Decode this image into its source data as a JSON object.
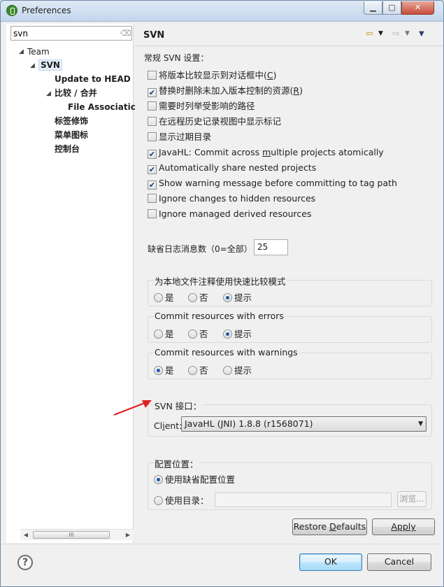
{
  "window": {
    "title": "Preferences",
    "min_label": "▁",
    "max_label": "▢",
    "close_label": "✕"
  },
  "left": {
    "search_value": "svn",
    "tree": [
      {
        "label": "Team",
        "arrow": "◢",
        "bold": false
      },
      {
        "label": "SVN",
        "arrow": "◢",
        "bold": true
      },
      {
        "label": "Update to HEAD",
        "arrow": "",
        "bold": true
      },
      {
        "label": "比较 / 合并",
        "arrow": "◢",
        "bold": true
      },
      {
        "label": "File Associatic",
        "arrow": "",
        "bold": true
      },
      {
        "label": "标签修饰",
        "arrow": "",
        "bold": true
      },
      {
        "label": "菜单图标",
        "arrow": "",
        "bold": true
      },
      {
        "label": "控制台",
        "arrow": "",
        "bold": true
      }
    ],
    "scroll_left": "◀",
    "scroll_thumb": "III",
    "scroll_right": "▶"
  },
  "right": {
    "title": "SVN",
    "general_heading": "常规 SVN 设置：",
    "checkboxes": [
      {
        "pre": "将版本比较显示到对话框中(",
        "key": "C",
        "post": ")",
        "checked": false
      },
      {
        "pre": "替换时删除未加入版本控制的资源(",
        "key": "R",
        "post": ")",
        "checked": true
      },
      {
        "pre": "需要时列举受影响的路径",
        "key": "",
        "post": "",
        "checked": false
      },
      {
        "pre": "在远程历史记录视图中显示标记",
        "key": "",
        "post": "",
        "checked": false
      },
      {
        "pre": "显示过期目录",
        "key": "",
        "post": "",
        "checked": false
      },
      {
        "pre": "JavaHL: Commit across ",
        "key": "m",
        "post": "ultiple projects atomically",
        "checked": true
      },
      {
        "pre": "Automatically share nested projects",
        "key": "",
        "post": "",
        "checked": true
      },
      {
        "pre": "Show warning message before committing to tag path",
        "key": "",
        "post": "",
        "checked": true
      },
      {
        "pre": "Ignore changes to hidden resources",
        "key": "",
        "post": "",
        "checked": false
      },
      {
        "pre": "Ignore managed derived resources",
        "key": "",
        "post": "",
        "checked": false
      }
    ],
    "log_label": "缺省日志消息数（0=全部）",
    "log_value": "25",
    "groups": [
      {
        "title": "为本地文件注释使用快速比较模式",
        "options": [
          "是",
          "否",
          "提示"
        ],
        "selected": 2
      },
      {
        "title": "Commit resources with errors",
        "options": [
          "是",
          "否",
          "提示"
        ],
        "selected": 2
      },
      {
        "title": "Commit resources with warnings",
        "options": [
          "是",
          "否",
          "提示"
        ],
        "selected": 0
      }
    ],
    "interface": {
      "title": "SVN 接口：",
      "client_pre": "Cl",
      "client_key": "i",
      "client_post": "ent:",
      "client_value": "JavaHL (JNI) 1.8.8 (r1568071)"
    },
    "config": {
      "title": "配置位置：",
      "default_label": "使用缺省配置位置",
      "dir_label": "使用目录：",
      "browse_label": "浏览..."
    },
    "restore_pre": "Restore ",
    "restore_key": "D",
    "restore_post": "efaults",
    "apply_label": "Apply"
  },
  "footer": {
    "help_label": "?",
    "ok_label": "OK",
    "cancel_label": "Cancel"
  },
  "colors": {
    "annotation_arrow": "#e02020",
    "accent": "#1e5aa8"
  }
}
